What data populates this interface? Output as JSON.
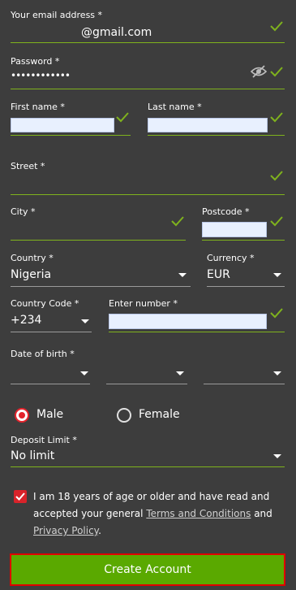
{
  "form": {
    "email": {
      "label": "Your email address *",
      "value": "@gmail.com"
    },
    "password": {
      "label": "Password *",
      "value": "••••••••••••"
    },
    "first_name": {
      "label": "First name *",
      "value": ""
    },
    "last_name": {
      "label": "Last name *",
      "value": ""
    },
    "street": {
      "label": "Street *",
      "value": ""
    },
    "city": {
      "label": "City *",
      "value": ""
    },
    "postcode": {
      "label": "Postcode *",
      "value": ""
    },
    "country": {
      "label": "Country *",
      "value": "Nigeria"
    },
    "currency": {
      "label": "Currency *",
      "value": "EUR"
    },
    "country_code": {
      "label": "Country Code *",
      "value": "+234"
    },
    "phone": {
      "label": "Enter number *",
      "value": ""
    },
    "dob": {
      "label": "Date of birth *",
      "day": "",
      "month": "",
      "year": ""
    },
    "gender": {
      "male": "Male",
      "female": "Female",
      "selected": "Male"
    },
    "deposit_limit": {
      "label": "Deposit Limit *",
      "value": "No limit"
    },
    "terms": {
      "prefix": "I am 18 years of age or older and have read and accepted your general",
      "terms_link": "Terms and Conditions",
      "and": "and",
      "privacy_link": "Privacy Policy",
      "suffix": ".",
      "checked": true
    },
    "submit_label": "Create Account"
  },
  "colors": {
    "background": "#3d3d3d",
    "valid_green": "#7fb21d",
    "button_green": "#5aa900",
    "focus_red": "#e00000",
    "radio_red": "#e3232c"
  },
  "icons": {
    "valid": "check-icon",
    "toggle_password": "eye-slash-icon",
    "dropdown": "caret-down-icon"
  }
}
